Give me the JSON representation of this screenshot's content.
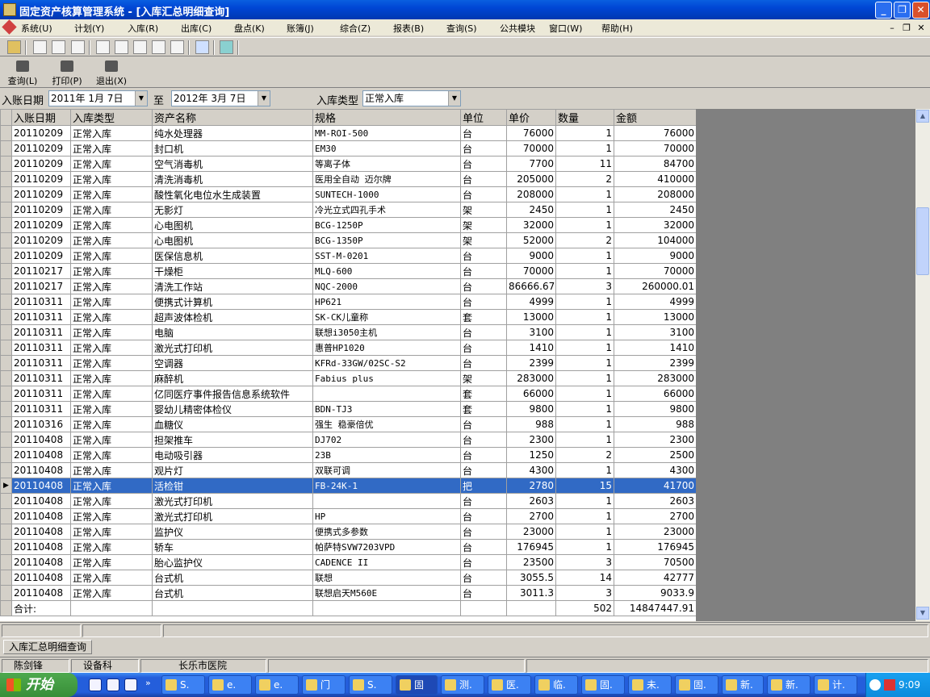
{
  "window": {
    "title": "固定资产核算管理系统 - [入库汇总明细查询]"
  },
  "menu": [
    "系统(U)",
    "计划(Y)",
    "入库(R)",
    "出库(C)",
    "盘点(K)",
    "账簿(J)",
    "综合(Z)",
    "报表(B)",
    "查询(S)",
    "公共模块",
    "窗口(W)",
    "帮助(H)"
  ],
  "toolbar2": {
    "query": "查询(L)",
    "print": "打印(P)",
    "exit": "退出(X)"
  },
  "filter": {
    "date_label": "入账日期",
    "date_from": "2011年 1月 7日",
    "to_label": "至",
    "date_to": "2012年 3月 7日",
    "type_label": "入库类型",
    "type_value": "正常入库"
  },
  "grid": {
    "headers": [
      "入账日期",
      "入库类型",
      "资产名称",
      "规格",
      "单位",
      "单价",
      "数量",
      "金额"
    ],
    "rows": [
      [
        "20110209",
        "正常入库",
        "纯水处理器",
        "MM-ROI-500",
        "台",
        "76000",
        "1",
        "76000"
      ],
      [
        "20110209",
        "正常入库",
        "封口机",
        "EM30",
        "台",
        "70000",
        "1",
        "70000"
      ],
      [
        "20110209",
        "正常入库",
        "空气消毒机",
        "等离子体",
        "台",
        "7700",
        "11",
        "84700"
      ],
      [
        "20110209",
        "正常入库",
        "清洗消毒机",
        "医用全自动 迈尔牌",
        "台",
        "205000",
        "2",
        "410000"
      ],
      [
        "20110209",
        "正常入库",
        "酸性氧化电位水生成装置",
        "SUNTECH-1000",
        "台",
        "208000",
        "1",
        "208000"
      ],
      [
        "20110209",
        "正常入库",
        "无影灯",
        "冷光立式四孔手术",
        "架",
        "2450",
        "1",
        "2450"
      ],
      [
        "20110209",
        "正常入库",
        "心电图机",
        "BCG-1250P",
        "架",
        "32000",
        "1",
        "32000"
      ],
      [
        "20110209",
        "正常入库",
        "心电图机",
        "BCG-1350P",
        "架",
        "52000",
        "2",
        "104000"
      ],
      [
        "20110209",
        "正常入库",
        "医保信息机",
        "SST-M-0201",
        "台",
        "9000",
        "1",
        "9000"
      ],
      [
        "20110217",
        "正常入库",
        "干燥柜",
        "MLQ-600",
        "台",
        "70000",
        "1",
        "70000"
      ],
      [
        "20110217",
        "正常入库",
        "清洗工作站",
        "NQC-2000",
        "台",
        "86666.67",
        "3",
        "260000.01"
      ],
      [
        "20110311",
        "正常入库",
        "便携式计算机",
        "HP621",
        "台",
        "4999",
        "1",
        "4999"
      ],
      [
        "20110311",
        "正常入库",
        "超声波体检机",
        "SK-CK儿童称",
        "套",
        "13000",
        "1",
        "13000"
      ],
      [
        "20110311",
        "正常入库",
        "电脑",
        "联想i3050主机",
        "台",
        "3100",
        "1",
        "3100"
      ],
      [
        "20110311",
        "正常入库",
        "激光式打印机",
        "惠普HP1020",
        "台",
        "1410",
        "1",
        "1410"
      ],
      [
        "20110311",
        "正常入库",
        "空调器",
        "KFRd-33GW/02SC-S2",
        "台",
        "2399",
        "1",
        "2399"
      ],
      [
        "20110311",
        "正常入库",
        "麻醉机",
        "Fabius plus",
        "架",
        "283000",
        "1",
        "283000"
      ],
      [
        "20110311",
        "正常入库",
        "亿同医疗事件报告信息系统软件",
        "",
        "套",
        "66000",
        "1",
        "66000"
      ],
      [
        "20110311",
        "正常入库",
        "婴幼儿精密体检仪",
        "BDN-TJ3",
        "套",
        "9800",
        "1",
        "9800"
      ],
      [
        "20110316",
        "正常入库",
        "血糖仪",
        "强生 稳豪倍优",
        "台",
        "988",
        "1",
        "988"
      ],
      [
        "20110408",
        "正常入库",
        "担架推车",
        "DJ702",
        "台",
        "2300",
        "1",
        "2300"
      ],
      [
        "20110408",
        "正常入库",
        "电动吸引器",
        "23B",
        "台",
        "1250",
        "2",
        "2500"
      ],
      [
        "20110408",
        "正常入库",
        "观片灯",
        "双联可调",
        "台",
        "4300",
        "1",
        "4300"
      ],
      [
        "20110408",
        "正常入库",
        "活检钳",
        "FB-24K-1",
        "把",
        "2780",
        "15",
        "41700"
      ],
      [
        "20110408",
        "正常入库",
        "激光式打印机",
        "",
        "台",
        "2603",
        "1",
        "2603"
      ],
      [
        "20110408",
        "正常入库",
        "激光式打印机",
        "HP",
        "台",
        "2700",
        "1",
        "2700"
      ],
      [
        "20110408",
        "正常入库",
        "监护仪",
        "便携式多参数",
        "台",
        "23000",
        "1",
        "23000"
      ],
      [
        "20110408",
        "正常入库",
        "轿车",
        "帕萨特SVW7203VPD",
        "台",
        "176945",
        "1",
        "176945"
      ],
      [
        "20110408",
        "正常入库",
        "胎心监护仪",
        "CADENCE II",
        "台",
        "23500",
        "3",
        "70500"
      ],
      [
        "20110408",
        "正常入库",
        "台式机",
        "联想",
        "台",
        "3055.5",
        "14",
        "42777"
      ],
      [
        "20110408",
        "正常入库",
        "台式机",
        "联想启天M560E",
        "台",
        "3011.3",
        "3",
        "9033.9"
      ]
    ],
    "selected_row": 23,
    "total_label": "合计:",
    "total_qty": "502",
    "total_amount": "14847447.91"
  },
  "tab": "入库汇总明细查询",
  "status": {
    "user": "陈剑锋",
    "dept": "设备科",
    "org": "长乐市医院"
  },
  "taskbar": {
    "start": "开始",
    "tasks": [
      "S.",
      "e.",
      "e.",
      "门",
      "S.",
      "固",
      "测.",
      "医.",
      "临.",
      "固.",
      "未.",
      "固.",
      "新.",
      "新.",
      "计."
    ],
    "active_task": 5,
    "clock": "9:09"
  }
}
